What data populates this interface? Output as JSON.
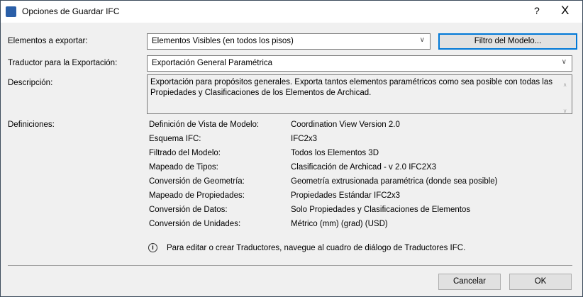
{
  "window": {
    "title": "Opciones de Guardar IFC",
    "help": "?",
    "close": "X"
  },
  "export_elements": {
    "label": "Elementos a exportar:",
    "value": "Elementos Visibles (en todos los pisos)",
    "filter_button": "Filtro del Modelo..."
  },
  "translator": {
    "label": "Traductor para la Exportación:",
    "value": "Exportación General Paramétrica"
  },
  "description": {
    "label": "Descripción:",
    "text": "Exportación para propósitos generales. Exporta tantos elementos paramétricos como sea posible con todas las Propiedades y Clasificaciones de los Elementos de Archicad."
  },
  "definitions": {
    "label": "Definiciones:",
    "rows": [
      {
        "key": "Definición de Vista de Modelo:",
        "value": "Coordination View Version 2.0"
      },
      {
        "key": "Esquema IFC:",
        "value": "IFC2x3"
      },
      {
        "key": "Filtrado del Modelo:",
        "value": "Todos los Elementos 3D"
      },
      {
        "key": "Mapeado de Tipos:",
        "value": "Clasificación de Archicad - v 2.0 IFC2X3"
      },
      {
        "key": "Conversión de Geometría:",
        "value": "Geometría extrusionada paramétrica (donde sea posible)"
      },
      {
        "key": "Mapeado de Propiedades:",
        "value": "Propiedades Estándar IFC2x3"
      },
      {
        "key": "Conversión de Datos:",
        "value": "Solo Propiedades y Clasificaciones de Elementos"
      },
      {
        "key": "Conversión de Unidades:",
        "value": "Métrico (mm) (grad) (USD)"
      }
    ]
  },
  "info_text": "Para editar o crear Traductores, navegue al cuadro de diálogo de Traductores IFC.",
  "buttons": {
    "cancel": "Cancelar",
    "ok": "OK"
  }
}
